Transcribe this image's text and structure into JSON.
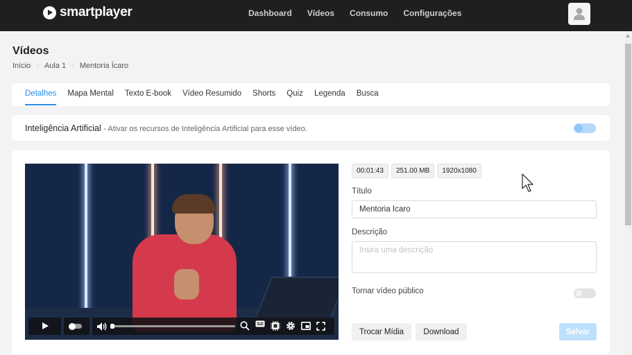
{
  "brand": {
    "name": "smartplayer"
  },
  "nav": {
    "items": [
      "Dashboard",
      "Vídeos",
      "Consumo",
      "Configurações"
    ]
  },
  "page": {
    "title": "Vídeos",
    "breadcrumb": [
      "Início",
      "Aula 1",
      "Mentoria Ícaro"
    ]
  },
  "tabs": [
    {
      "label": "Detalhes",
      "active": true
    },
    {
      "label": "Mapa Mental",
      "active": false
    },
    {
      "label": "Texto E-book",
      "active": false
    },
    {
      "label": "Vídeo Resumido",
      "active": false
    },
    {
      "label": "Shorts",
      "active": false
    },
    {
      "label": "Quiz",
      "active": false
    },
    {
      "label": "Legenda",
      "active": false
    },
    {
      "label": "Busca",
      "active": false
    }
  ],
  "ai": {
    "title": "Inteligência Artificial",
    "description": "- Ativar os recursos de Inteligência Artificial para esse vídeo.",
    "enabled": true
  },
  "video": {
    "duration": "00:01:43",
    "size": "251.00 MB",
    "resolution": "1920x1080",
    "progress": 0.0
  },
  "form": {
    "title_label": "Título",
    "title_value": "Mentoria Ícaro",
    "description_label": "Descrição",
    "description_placeholder": "Insira uma descrição",
    "public_label": "Tornar vídeo público",
    "public_enabled": false
  },
  "buttons": {
    "replace_media": "Trocar Mídia",
    "download": "Download",
    "save": "Salvar"
  },
  "colors": {
    "accent": "#2b8ee8",
    "topbar": "#1f1f1f",
    "save_disabled": "#bde0fc"
  }
}
